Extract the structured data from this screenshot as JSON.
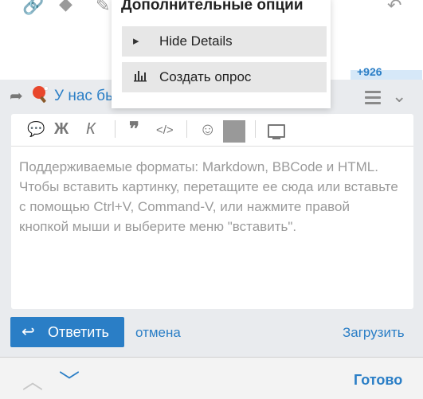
{
  "top_icons": {
    "link": "link-icon",
    "tag": "tag-icon",
    "pencil": "pencil-icon",
    "back": "back-arrow-icon"
  },
  "blue_strip_text": "+926",
  "composer": {
    "topic_text": "У нас бы",
    "toolbar": {
      "bold": "Ж",
      "italic": "К",
      "quote": "❞",
      "code": "</>",
      "emoji": "☺"
    },
    "placeholder": "Поддерживаемые форматы: Markdown, BBCode и HTML. Чтобы вставить картинку, перетащите ее сюда или вставьте с помощью Ctrl+V, Command-V, или нажмите правой кнопкой мыши и выберите меню \"вставить\".",
    "swatch_color": "#999999"
  },
  "actions": {
    "reply_label": "Ответить",
    "cancel_label": "отмена",
    "upload_label": "Загрузить"
  },
  "bottom": {
    "done_label": "Готово"
  },
  "popup": {
    "title": "Дополнительные опции",
    "options": [
      {
        "label": "Hide Details",
        "icon": "caret-right-icon"
      },
      {
        "label": "Создать опрос",
        "icon": "bar-chart-icon"
      }
    ]
  },
  "colors": {
    "accent": "#2a7ec6",
    "background": "#e9ebee"
  }
}
